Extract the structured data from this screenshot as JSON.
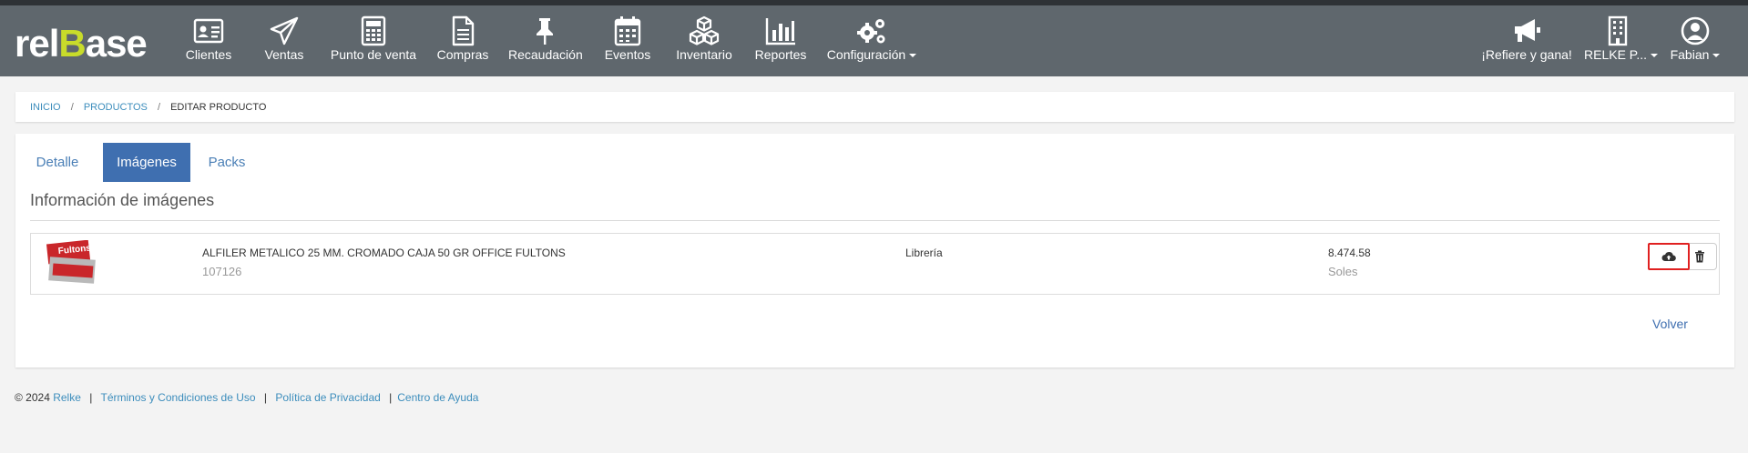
{
  "brand": {
    "logo_prefix": "rel",
    "logo_b": "B",
    "logo_suffix": "ase",
    "accent": "#c8dc2a"
  },
  "nav": {
    "items": [
      {
        "label": "Clientes",
        "icon": "id-card-icon"
      },
      {
        "label": "Ventas",
        "icon": "paper-plane-icon"
      },
      {
        "label": "Punto de venta",
        "icon": "calculator-icon"
      },
      {
        "label": "Compras",
        "icon": "document-icon"
      },
      {
        "label": "Recaudación",
        "icon": "pushpin-icon"
      },
      {
        "label": "Eventos",
        "icon": "calendar-icon"
      },
      {
        "label": "Inventario",
        "icon": "cubes-icon"
      },
      {
        "label": "Reportes",
        "icon": "bar-chart-icon"
      },
      {
        "label": "Configuración",
        "icon": "gears-icon"
      }
    ],
    "right": [
      {
        "label": "¡Refiere y gana!",
        "icon": "megaphone-icon"
      },
      {
        "label": "RELKE P...",
        "icon": "building-icon"
      },
      {
        "label": "Fabian",
        "icon": "user-icon"
      }
    ]
  },
  "breadcrumb": {
    "home": "INICIO",
    "section": "PRODUCTOS",
    "current": "EDITAR PRODUCTO",
    "separator": "/"
  },
  "tabs": [
    {
      "label": "Detalle",
      "active": false
    },
    {
      "label": "Imágenes",
      "active": true
    },
    {
      "label": "Packs",
      "active": false
    }
  ],
  "section_title": "Información de imágenes",
  "product": {
    "name": "ALFILER METALICO 25 MM. CROMADO CAJA 50 GR OFFICE FULTONS",
    "code": "107126",
    "category": "Librería",
    "price": "8.474.58",
    "currency": "Soles",
    "thumb_text": "Fultons"
  },
  "actions": {
    "upload_icon": "cloud-upload-icon",
    "delete_icon": "trash-icon"
  },
  "back_label": "Volver",
  "footer": {
    "copyright": "© 2024",
    "company": "Relke",
    "terms": "Términos y Condiciones de Uso",
    "privacy": "Política de Privacidad",
    "help": "Centro de Ayuda"
  },
  "colors": {
    "navbar": "#5f676d",
    "tab_active": "#3f6fb0",
    "link": "#3c8dbc",
    "highlight": "#e02020"
  }
}
